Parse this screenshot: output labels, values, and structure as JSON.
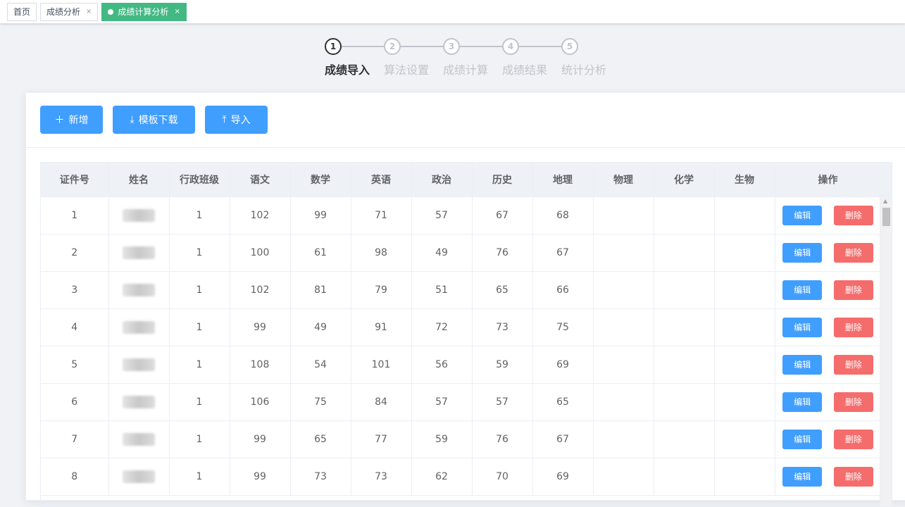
{
  "tags": [
    {
      "label": "首页",
      "closable": false,
      "active": false
    },
    {
      "label": "成绩分析",
      "closable": true,
      "active": false
    },
    {
      "label": "成绩计算分析",
      "closable": true,
      "active": true
    }
  ],
  "close_glyph": "×",
  "steps": [
    {
      "num": "1",
      "label": "成绩导入",
      "active": true
    },
    {
      "num": "2",
      "label": "算法设置",
      "active": false
    },
    {
      "num": "3",
      "label": "成绩计算",
      "active": false
    },
    {
      "num": "4",
      "label": "成绩结果",
      "active": false
    },
    {
      "num": "5",
      "label": "统计分析",
      "active": false
    }
  ],
  "toolbar": {
    "add_label": "新增",
    "download_label": "模板下载",
    "import_label": "导入"
  },
  "table": {
    "headers": [
      "证件号",
      "姓名",
      "行政班级",
      "语文",
      "数学",
      "英语",
      "政治",
      "历史",
      "地理",
      "物理",
      "化学",
      "生物",
      "操作"
    ],
    "edit_label": "编辑",
    "delete_label": "删除",
    "rows": [
      {
        "id": "1",
        "class": "1",
        "scores": [
          "102",
          "99",
          "71",
          "57",
          "67",
          "68",
          "",
          "",
          ""
        ]
      },
      {
        "id": "2",
        "class": "1",
        "scores": [
          "100",
          "61",
          "98",
          "49",
          "76",
          "67",
          "",
          "",
          ""
        ]
      },
      {
        "id": "3",
        "class": "1",
        "scores": [
          "102",
          "81",
          "79",
          "51",
          "65",
          "66",
          "",
          "",
          ""
        ]
      },
      {
        "id": "4",
        "class": "1",
        "scores": [
          "99",
          "49",
          "91",
          "72",
          "73",
          "75",
          "",
          "",
          ""
        ]
      },
      {
        "id": "5",
        "class": "1",
        "scores": [
          "108",
          "54",
          "101",
          "56",
          "59",
          "69",
          "",
          "",
          ""
        ]
      },
      {
        "id": "6",
        "class": "1",
        "scores": [
          "106",
          "75",
          "84",
          "57",
          "57",
          "65",
          "",
          "",
          ""
        ]
      },
      {
        "id": "7",
        "class": "1",
        "scores": [
          "99",
          "65",
          "77",
          "59",
          "76",
          "67",
          "",
          "",
          ""
        ]
      },
      {
        "id": "8",
        "class": "1",
        "scores": [
          "99",
          "73",
          "73",
          "62",
          "70",
          "69",
          "",
          "",
          ""
        ]
      }
    ]
  },
  "colors": {
    "primary": "#409eff",
    "danger": "#f56c6c",
    "active_tag": "#42b983"
  },
  "icons": {
    "add": "plus-icon",
    "download": "download-icon",
    "import": "upload-icon"
  }
}
